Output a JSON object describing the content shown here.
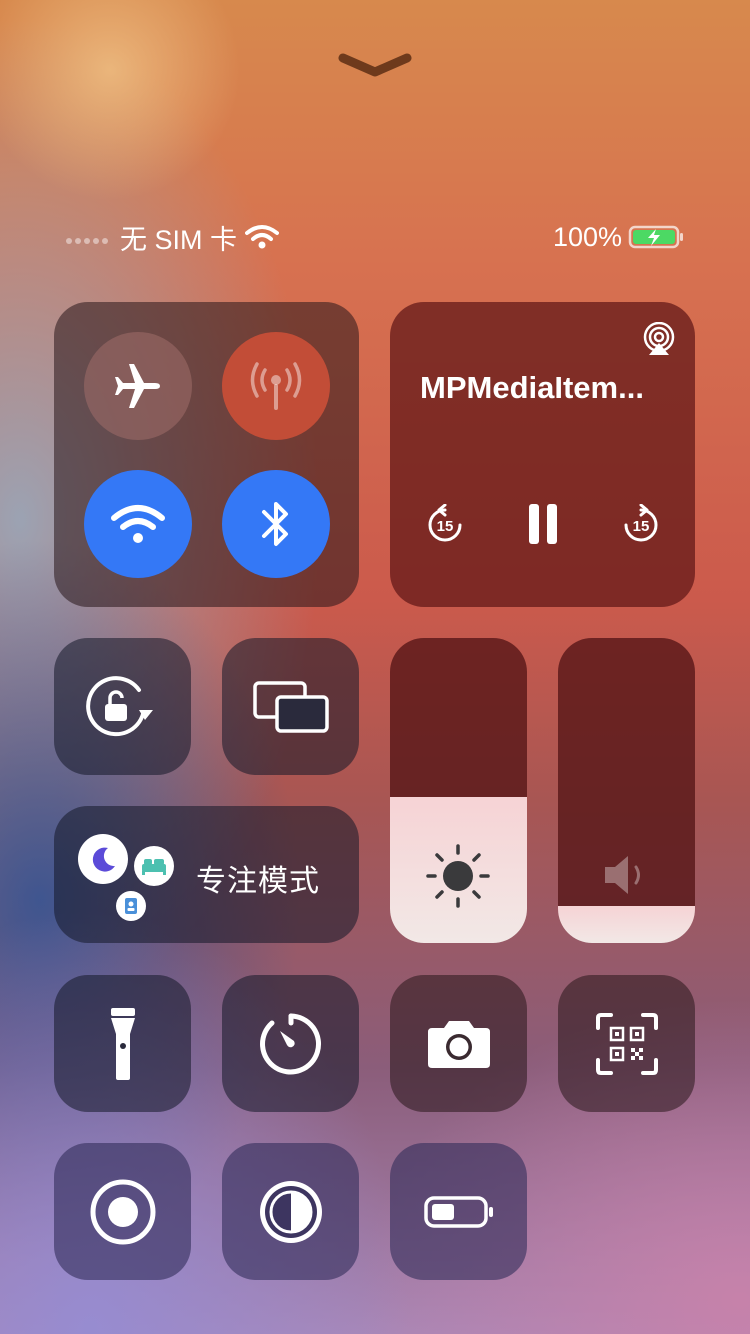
{
  "status_bar": {
    "carrier": "无 SIM 卡",
    "battery_percent": "100%",
    "icons": [
      "signal-dots-icon",
      "wifi-icon",
      "battery-charging-icon"
    ]
  },
  "connectivity": {
    "airplane": {
      "icon": "airplane-icon",
      "active": false
    },
    "cellular": {
      "icon": "cellular-antenna-icon",
      "active": false
    },
    "wifi": {
      "icon": "wifi-icon",
      "active": true
    },
    "bluetooth": {
      "icon": "bluetooth-icon",
      "active": true
    }
  },
  "media": {
    "title": "MPMediaItem...",
    "airplay_icon": "airplay-audio-icon",
    "skip_back_seconds": "15",
    "skip_forward_seconds": "15",
    "playing": true
  },
  "focus": {
    "label": "专注模式",
    "icons": [
      "moon-icon",
      "bed-icon",
      "badge-icon"
    ]
  },
  "sliders": {
    "brightness_level": 0.48,
    "volume_level": 0.12
  },
  "tiles": {
    "rotation_lock": "rotation-lock-icon",
    "screen_mirroring": "screen-mirroring-icon",
    "flashlight": "flashlight-icon",
    "timer": "timer-icon",
    "camera": "camera-icon",
    "qr_scanner": "qr-scanner-icon",
    "screen_record": "screen-record-icon",
    "dark_mode": "dark-mode-icon",
    "low_power": "low-power-battery-icon"
  },
  "colors": {
    "accent_blue": "#3478f6",
    "cellular_inactive": "#c24d37"
  }
}
